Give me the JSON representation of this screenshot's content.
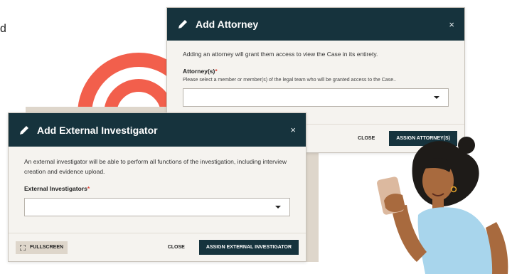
{
  "background": {
    "letter": "d",
    "colors": {
      "rings": "#f25f4c",
      "block": "#ded6cb"
    }
  },
  "attorney_modal": {
    "title": "Add Attorney",
    "close_label": "×",
    "description": "Adding an attorney will grant them access to view the Case in its entirety.",
    "field_label": "Attorney(s)",
    "required_mark": "*",
    "help_text": "Please select a member or member(s) of the legal team who will be granted access to the Case..",
    "select_value": "",
    "close_button": "CLOSE",
    "assign_button": "ASSIGN ATTORNEY(S)"
  },
  "investigator_modal": {
    "title": "Add External Investigator",
    "close_label": "×",
    "description": "An external investigator will be able to perform all functions of the investigation, including interview creation and evidence upload.",
    "field_label": "External Investigators",
    "required_mark": "*",
    "select_value": "",
    "fullscreen_button": "FULLSCREEN",
    "close_button": "CLOSE",
    "assign_button": "ASSIGN EXTERNAL INVESTIGATOR"
  },
  "colors": {
    "header": "#16333d",
    "modal_bg": "#f5f3ef",
    "required": "#e0463a"
  },
  "icons": [
    "pencil-icon",
    "close-icon",
    "chevron-down-icon",
    "fullscreen-icon"
  ]
}
